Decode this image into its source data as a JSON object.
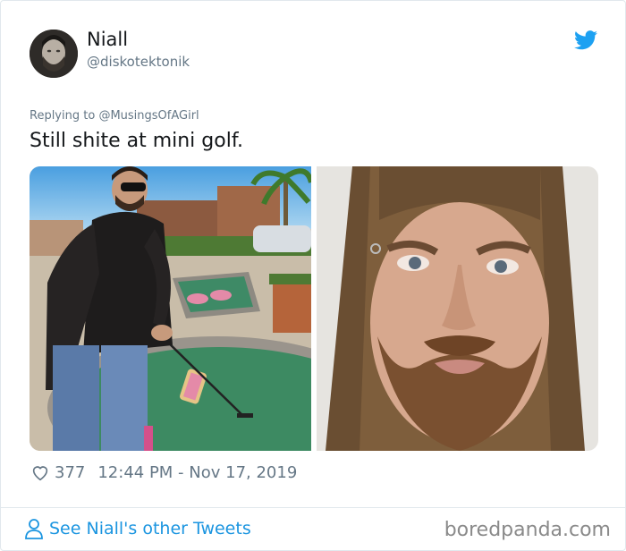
{
  "tweet": {
    "author": {
      "name": "Niall",
      "handle": "@diskotektonik"
    },
    "reply": {
      "prefix": "Replying to",
      "mention": "@MusingsOfAGirl"
    },
    "text": "Still shite at mini golf.",
    "likes": "377",
    "timestamp": "12:44 PM - Nov 17, 2019",
    "see_more": "See Niall's other Tweets"
  },
  "watermark": "boredpanda.com",
  "icons": {
    "brand": "twitter-bird-icon",
    "like": "heart-icon",
    "profile": "person-icon"
  },
  "colors": {
    "twitter_blue": "#1da1f2",
    "link": "#1b95e0",
    "muted": "#657786"
  }
}
